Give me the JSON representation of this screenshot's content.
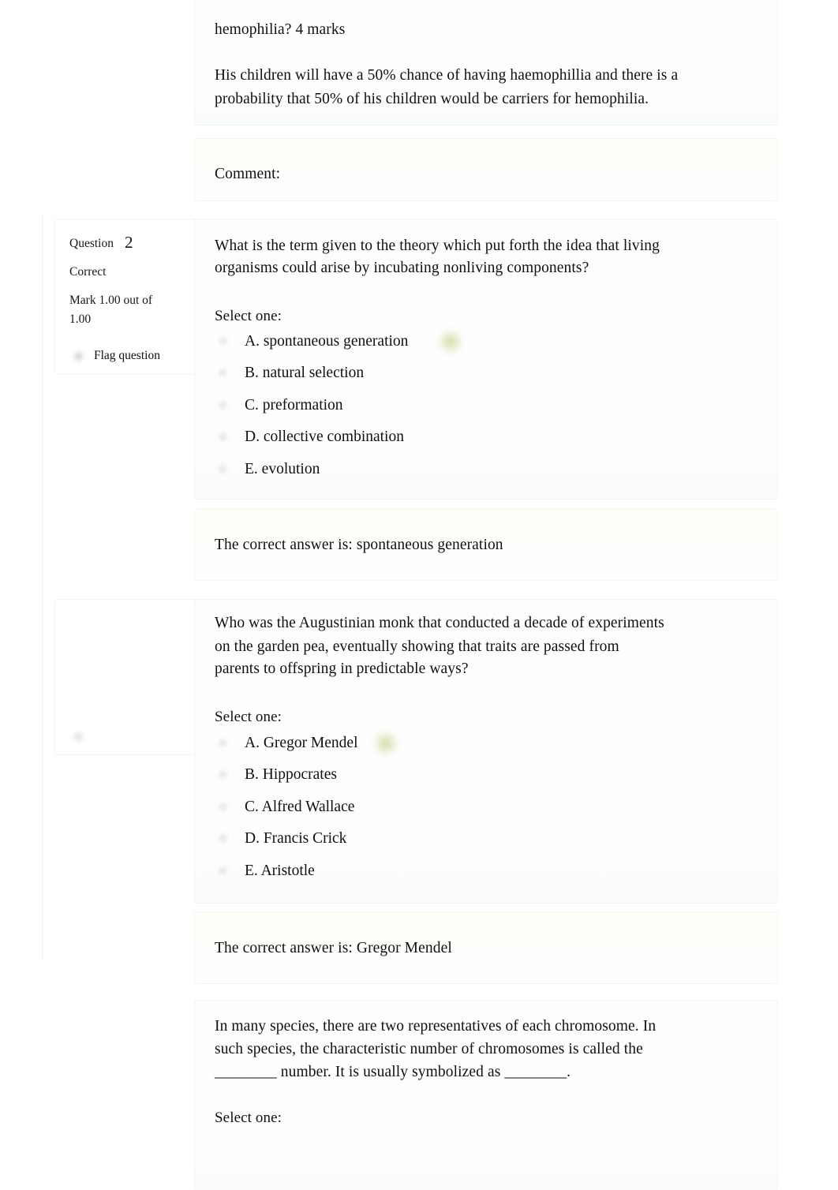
{
  "page": {
    "accent_green": "#aabe5a",
    "text_color": "#101010"
  },
  "question_one_tail": {
    "prompt_tail": "hemophilia? 4 marks",
    "response": "His children will have a 50% chance of having haemophillia and there is a probability that 50% of his children would be carriers for hemophilia.",
    "comment_label": "Comment:"
  },
  "question_two": {
    "info": {
      "question_label": "Question",
      "question_number": "2",
      "state": "Correct",
      "mark_line1": "Mark 1.00 out of",
      "mark_line2": "1.00",
      "flag_label": "Flag question",
      "flag_icon": "flag-icon"
    },
    "stem_line1": "What is the term given to the theory which put forth the idea that living",
    "stem_line2": "organisms could arise by incubating nonliving components?",
    "select_label": "Select one:",
    "options": [
      {
        "label": "A. spontaneous generation",
        "correct": true
      },
      {
        "label": "B. natural selection",
        "correct": false
      },
      {
        "label": "C. preformation",
        "correct": false
      },
      {
        "label": "D. collective combination",
        "correct": false
      },
      {
        "label": "E. evolution",
        "correct": false
      }
    ],
    "correct_answer_text": "The correct answer is: spontaneous generation"
  },
  "question_three": {
    "info": {
      "flag_icon": "flag-icon"
    },
    "stem_line1": "Who was the Augustinian monk that conducted a decade of experiments",
    "stem_line2": "on the garden pea, eventually showing that traits are passed from",
    "stem_line3": "parents to offspring in predictable ways?",
    "select_label": "Select one:",
    "options": [
      {
        "label": "A. Gregor Mendel",
        "correct": true
      },
      {
        "label": "B. Hippocrates",
        "correct": false
      },
      {
        "label": "C. Alfred Wallace",
        "correct": false
      },
      {
        "label": "D. Francis Crick",
        "correct": false
      },
      {
        "label": "E. Aristotle",
        "correct": false
      }
    ],
    "correct_answer_text": "The correct answer is: Gregor Mendel"
  },
  "question_four": {
    "stem_line1": "In many species, there are two representatives of each chromosome. In",
    "stem_line2": "such species, the characteristic number of chromosomes is called the",
    "stem_line3": "________ number. It is usually symbolized as ________.",
    "select_label": "Select one:"
  }
}
